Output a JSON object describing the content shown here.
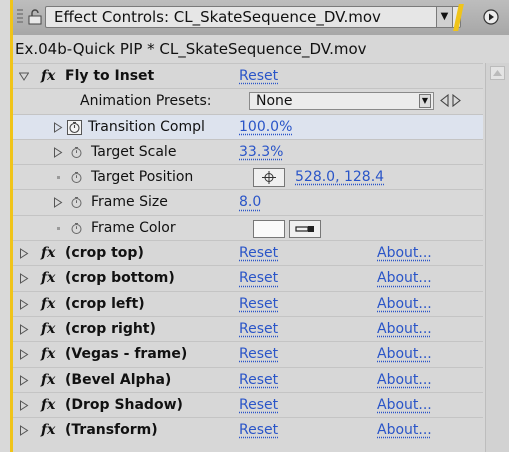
{
  "panel": {
    "tab_title": "Effect Controls: CL_SkateSequence_DV.mov",
    "subtitle": "Ex.04b-Quick PIP * CL_SkateSequence_DV.mov"
  },
  "effect_main": {
    "name": "Fly to Inset",
    "reset": "Reset",
    "presets_label": "Animation Presets:",
    "presets_value": "None",
    "properties": [
      {
        "label": "Transition Compl",
        "value": "100.0%"
      },
      {
        "label": "Target Scale",
        "value": "33.3%"
      },
      {
        "label": "Target Position",
        "value": "528.0, 128.4"
      },
      {
        "label": "Frame Size",
        "value": "8.0"
      },
      {
        "label": "Frame Color",
        "value": ""
      }
    ]
  },
  "effects": [
    {
      "name": "(crop top)",
      "reset": "Reset",
      "about": "About..."
    },
    {
      "name": "(crop bottom)",
      "reset": "Reset",
      "about": "About..."
    },
    {
      "name": "(crop left)",
      "reset": "Reset",
      "about": "About..."
    },
    {
      "name": "(crop right)",
      "reset": "Reset",
      "about": "About..."
    },
    {
      "name": "(Vegas - frame)",
      "reset": "Reset",
      "about": "About..."
    },
    {
      "name": "(Bevel Alpha)",
      "reset": "Reset",
      "about": "About..."
    },
    {
      "name": "(Drop Shadow)",
      "reset": "Reset",
      "about": "About..."
    },
    {
      "name": "(Transform)",
      "reset": "Reset",
      "about": "About..."
    }
  ],
  "colors": {
    "accent": "#f0c419",
    "link": "#2a55c8",
    "frame_color_swatch": "#fafafa"
  }
}
